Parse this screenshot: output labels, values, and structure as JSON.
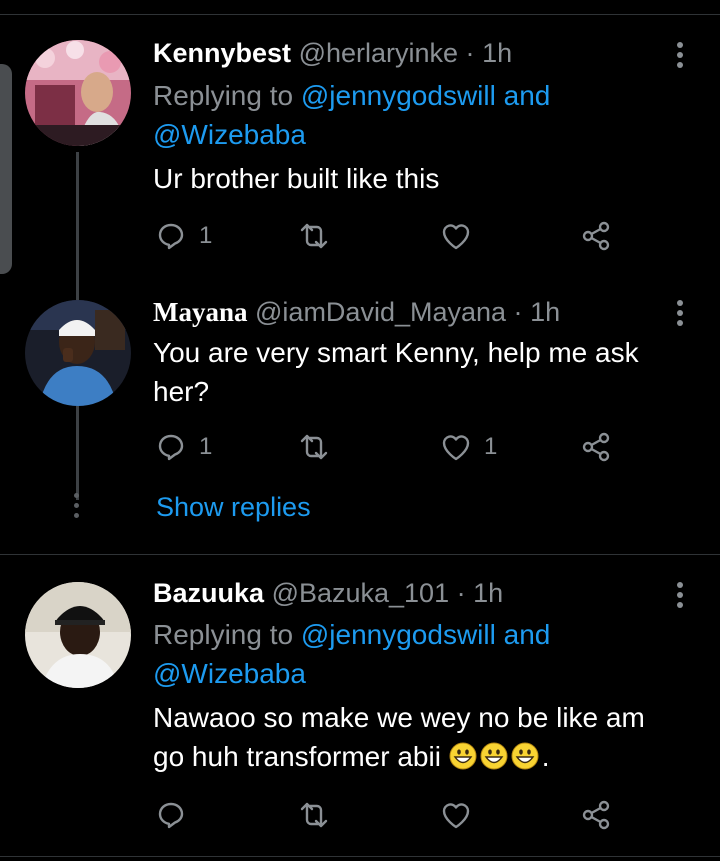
{
  "tweets": [
    {
      "name": "Kennybest",
      "handle": "@herlaryinke",
      "separator": "·",
      "time": "1h",
      "replying_prefix": "Replying to",
      "replying_mentions": "@jennygodswill and",
      "replying_mentions2": "@Wizebaba",
      "text": "Ur brother built like this",
      "reply_count": "1",
      "like_count": ""
    },
    {
      "name": "Mayana",
      "handle": "@iamDavid_Mayana",
      "separator": "·",
      "time": "1h",
      "text": "You are very smart Kenny, help me ask her?",
      "reply_count": "1",
      "like_count": "1"
    },
    {
      "name": "Bazuuka",
      "handle": "@Bazuka_101",
      "separator": "·",
      "time": "1h",
      "replying_prefix": "Replying to",
      "replying_mentions": "@jennygodswill and",
      "replying_mentions2": "@Wizebaba",
      "text_line1": "Nawaoo so make we wey no be like am",
      "text_line2": "go huh transformer abii",
      "text_tail": ".",
      "emoji": "grinning-face-emoji",
      "reply_count": "",
      "like_count": ""
    }
  ],
  "show_replies_label": "Show replies",
  "icons": {
    "reply": "reply-icon",
    "retweet": "retweet-icon",
    "like": "heart-icon",
    "share": "share-icon",
    "more": "more-vertical-icon"
  },
  "colors": {
    "background": "#000000",
    "accent": "#1d9bf0",
    "muted": "#8b9095",
    "divider": "#2f3336"
  }
}
